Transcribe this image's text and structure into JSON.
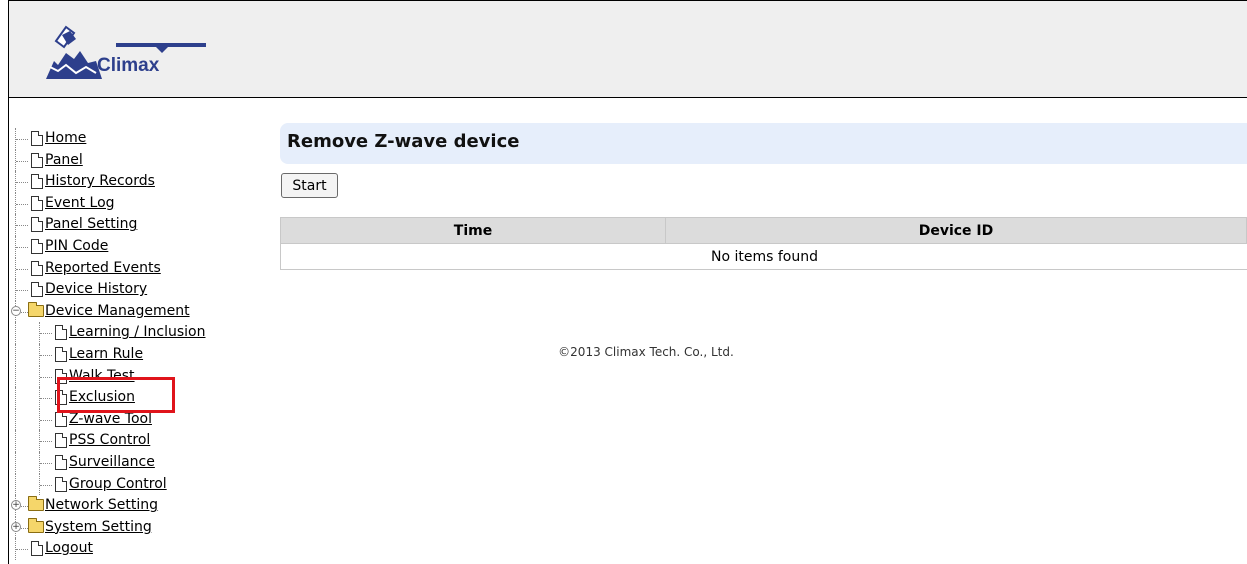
{
  "logo": {
    "text": "Climax"
  },
  "sidebar": {
    "items": [
      {
        "label": "Home",
        "type": "doc",
        "level": 0
      },
      {
        "label": "Panel",
        "type": "doc",
        "level": 0
      },
      {
        "label": "History Records",
        "type": "doc",
        "level": 0
      },
      {
        "label": "Event Log",
        "type": "doc",
        "level": 0
      },
      {
        "label": "Panel Setting",
        "type": "doc",
        "level": 0
      },
      {
        "label": "PIN Code",
        "type": "doc",
        "level": 0
      },
      {
        "label": "Reported Events",
        "type": "doc",
        "level": 0
      },
      {
        "label": "Device History",
        "type": "doc",
        "level": 0
      },
      {
        "label": "Device Management",
        "type": "folder",
        "level": 0,
        "expander": "−"
      },
      {
        "label": "Learning / Inclusion",
        "type": "doc",
        "level": 1
      },
      {
        "label": "Learn Rule",
        "type": "doc",
        "level": 1
      },
      {
        "label": "Walk Test",
        "type": "doc",
        "level": 1
      },
      {
        "label": "Exclusion",
        "type": "doc",
        "level": 1,
        "selected": true
      },
      {
        "label": "Z-wave Tool",
        "type": "doc",
        "level": 1
      },
      {
        "label": "PSS Control",
        "type": "doc",
        "level": 1
      },
      {
        "label": "Surveillance",
        "type": "doc",
        "level": 1
      },
      {
        "label": "Group Control",
        "type": "doc",
        "level": 1
      },
      {
        "label": "Network Setting",
        "type": "folder",
        "level": 0,
        "expander": "+"
      },
      {
        "label": "System Setting",
        "type": "folder",
        "level": 0,
        "expander": "+"
      },
      {
        "label": "Logout",
        "type": "doc",
        "level": 0
      }
    ]
  },
  "main": {
    "title": "Remove Z-wave device",
    "start_label": "Start",
    "table": {
      "columns": [
        "Time",
        "Device ID"
      ],
      "empty_message": "No items found"
    }
  },
  "footer": {
    "copyright": "©2013 Climax Tech. Co., Ltd."
  },
  "colors": {
    "highlight": "#e0141b",
    "title_bar": "#e6eefb",
    "table_header": "#dcdcdc"
  }
}
